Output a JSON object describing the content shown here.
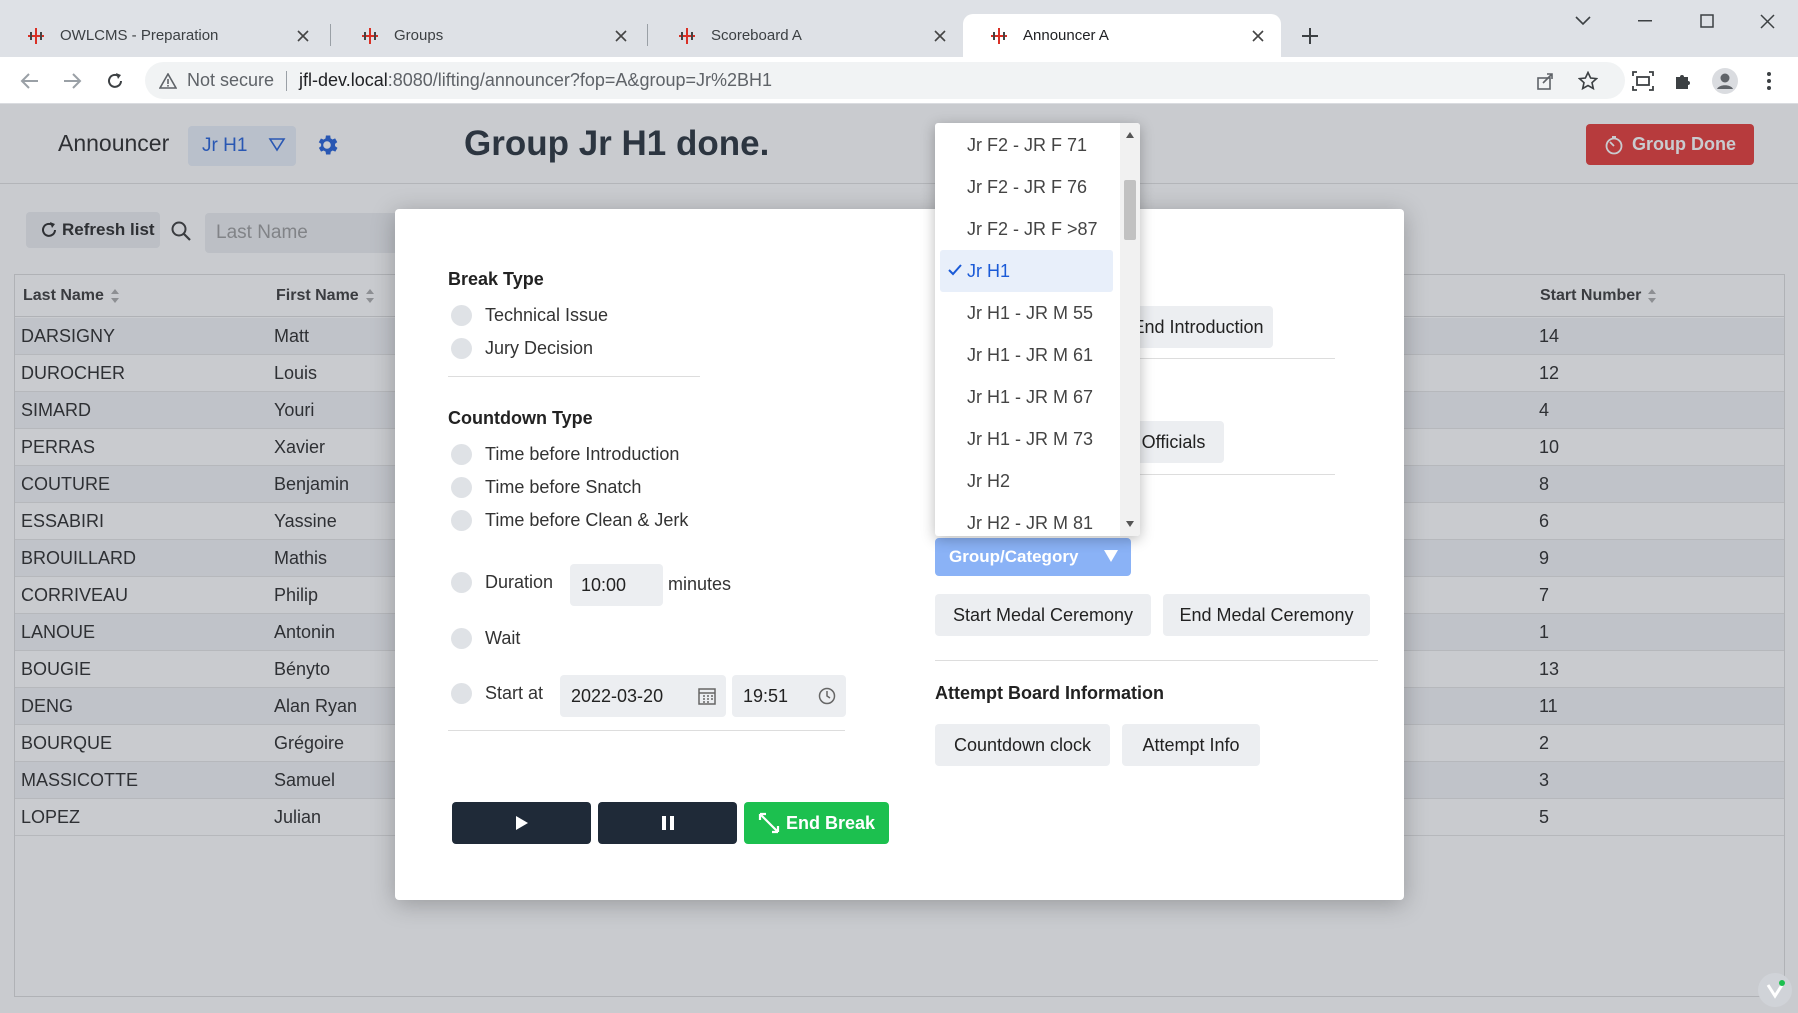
{
  "browser": {
    "tabs": [
      {
        "title": "OWLCMS - Preparation"
      },
      {
        "title": "Groups"
      },
      {
        "title": "Scoreboard A"
      },
      {
        "title": "Announcer A"
      }
    ],
    "security_label": "Not secure",
    "url_host": "jfl-dev.local",
    "url_path": ":8080/lifting/announcer?fop=A&group=Jr%2BH1"
  },
  "header": {
    "title": "Announcer",
    "group_selected": "Jr H1",
    "status_message": "Group Jr H1 done.",
    "group_done_label": "Group Done",
    "accent_color": "#1a5ad7",
    "danger_color": "#e6312e"
  },
  "toolbar": {
    "refresh_label": "Refresh list",
    "search_placeholder": "Last Name"
  },
  "grid": {
    "columns": [
      "Last Name",
      "First Name",
      "Start Number"
    ],
    "rows": [
      {
        "last": "DARSIGNY",
        "first": "Matt",
        "start": "14"
      },
      {
        "last": "DUROCHER",
        "first": "Louis",
        "start": "12"
      },
      {
        "last": "SIMARD",
        "first": "Youri",
        "start": "4"
      },
      {
        "last": "PERRAS",
        "first": "Xavier",
        "start": "10"
      },
      {
        "last": "COUTURE",
        "first": "Benjamin",
        "start": "8"
      },
      {
        "last": "ESSABIRI",
        "first": "Yassine",
        "start": "6"
      },
      {
        "last": "BROUILLARD",
        "first": "Mathis",
        "start": "9"
      },
      {
        "last": "CORRIVEAU",
        "first": "Philip",
        "start": "7"
      },
      {
        "last": "LANOUE",
        "first": "Antonin",
        "start": "1"
      },
      {
        "last": "BOUGIE",
        "first": "Bényto",
        "start": "13"
      },
      {
        "last": "DENG",
        "first": "Alan Ryan",
        "start": "11"
      },
      {
        "last": "BOURQUE",
        "first": "Grégoire",
        "start": "2"
      },
      {
        "last": "MASSICOTTE",
        "first": "Samuel",
        "start": "3"
      },
      {
        "last": "LOPEZ",
        "first": "Julian",
        "start": "5"
      }
    ]
  },
  "dialog": {
    "break_type_title": "Break Type",
    "break_types": [
      "Technical Issue",
      "Jury Decision"
    ],
    "countdown_type_title": "Countdown Type",
    "countdown_types": [
      "Time before Introduction",
      "Time before Snatch",
      "Time before Clean & Jerk"
    ],
    "duration_label": "Duration",
    "duration_value": "10:00",
    "duration_units": "minutes",
    "wait_label": "Wait",
    "start_at_label": "Start at",
    "start_date": "2022-03-20",
    "start_time": "19:51",
    "end_break_label": "End Break",
    "end_introduction_label": "End Introduction",
    "officials_label": "Officials",
    "group_category_label": "Group/Category",
    "start_medal_label": "Start Medal Ceremony",
    "end_medal_label": "End Medal Ceremony",
    "attempt_board_title": "Attempt Board Information",
    "countdown_clock_label": "Countdown clock",
    "attempt_info_label": "Attempt Info"
  },
  "dropdown": {
    "items": [
      "Jr F2 - JR F 71",
      "Jr F2 - JR F 76",
      "Jr F2 - JR F >87",
      "Jr H1",
      "Jr H1 - JR M 55",
      "Jr H1 - JR M 61",
      "Jr H1 - JR M 67",
      "Jr H1 - JR M 73",
      "Jr H2",
      "Jr H2 - JR M 81"
    ],
    "selected_index": 3
  }
}
